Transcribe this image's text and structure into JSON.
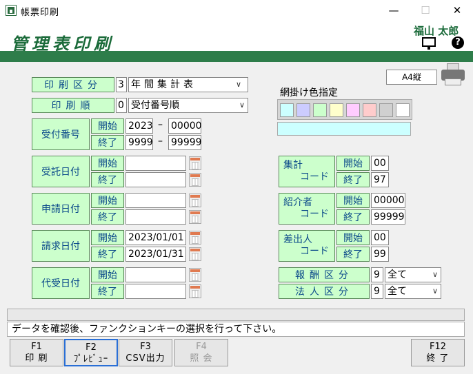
{
  "window": {
    "title": "帳票印刷",
    "minimize": "—",
    "maximize": "☐",
    "close": "✕"
  },
  "header": {
    "title": "管理表印刷",
    "user": "福山 太郎",
    "help": "?"
  },
  "print_settings": {
    "category_label": "印刷区分",
    "category_code": "3",
    "category_value": "年間集計表",
    "order_label": "印刷順",
    "order_code": "0",
    "order_value": "受付番号順"
  },
  "paper": "A4縦",
  "hatch": {
    "label": "網掛け色指定",
    "swatches": [
      "#ccffff",
      "#ccccff",
      "#ccffcc",
      "#ffffcc",
      "#ffccff",
      "#ffcccc",
      "#d0d0d0",
      "#ffffff"
    ],
    "selected": "#ccffff"
  },
  "common": {
    "start": "開始",
    "end": "終了",
    "dash": "–"
  },
  "receipt_number": {
    "label": "受付番号",
    "start_year": "2023",
    "start_no": "00000",
    "end_year": "9999",
    "end_no": "99999"
  },
  "consign_date": {
    "label": "受託日付",
    "start": "",
    "end": ""
  },
  "apply_date": {
    "label": "申請日付",
    "start": "",
    "end": ""
  },
  "bill_date": {
    "label": "請求日付",
    "start": "2023/01/01",
    "end": "2023/01/31"
  },
  "proxy_date": {
    "label": "代受日付",
    "start": "",
    "end": ""
  },
  "summary_code": {
    "label1": "集計",
    "label2": "コード",
    "start": "00",
    "end": "97"
  },
  "referrer_code": {
    "label1": "紹介者",
    "label2": "コード",
    "start": "00000",
    "end": "99999"
  },
  "sender_code": {
    "label1": "差出人",
    "label2": "コード",
    "start": "00",
    "end": "99"
  },
  "reward": {
    "label": "報酬区分",
    "code": "9",
    "value": "全て"
  },
  "corporation": {
    "label": "法人区分",
    "code": "9",
    "value": "全て"
  },
  "status": {
    "line1": "",
    "message": "データを確認後、ファンクションキーの選択を行って下さい。"
  },
  "fkeys": [
    {
      "key": "F1",
      "label": "印 刷"
    },
    {
      "key": "F2",
      "label": "ﾌﾟﾚﾋﾞｭｰ"
    },
    {
      "key": "F3",
      "label": "CSV出力"
    },
    {
      "key": "F4",
      "label": "照 会"
    },
    {
      "key": "F12",
      "label": "終 了"
    }
  ]
}
